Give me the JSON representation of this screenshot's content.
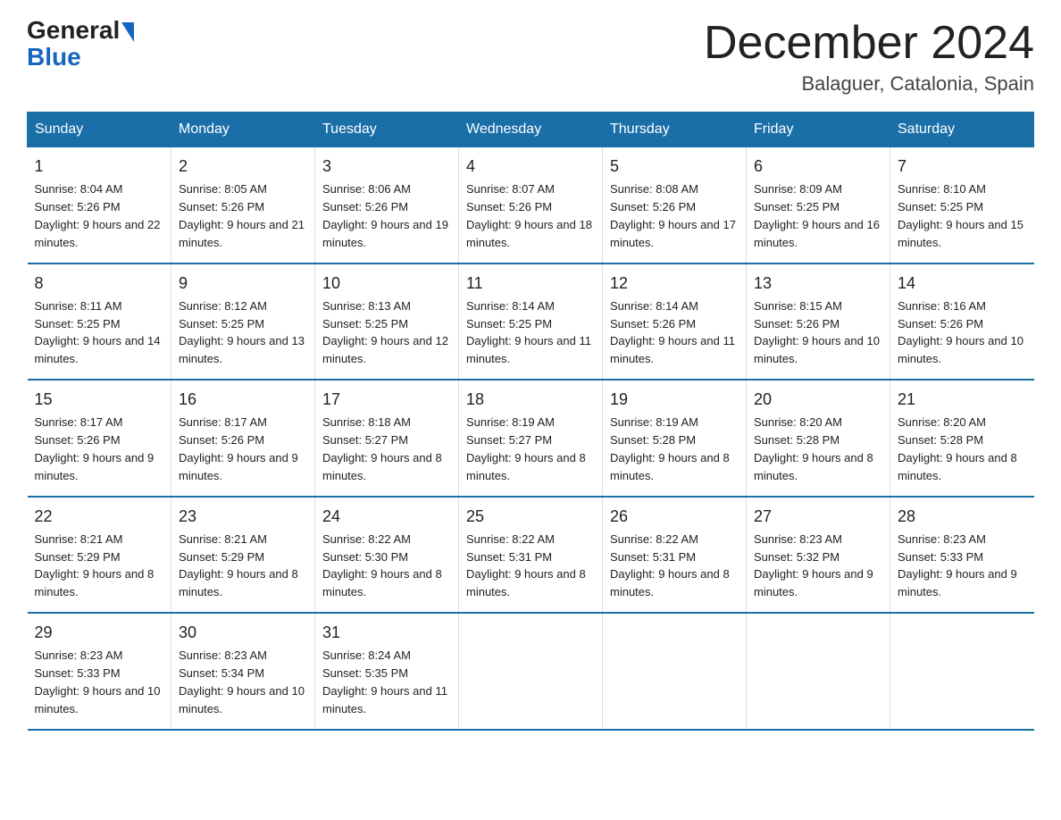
{
  "header": {
    "logo_general": "General",
    "logo_blue": "Blue",
    "month_title": "December 2024",
    "location": "Balaguer, Catalonia, Spain"
  },
  "days_of_week": [
    "Sunday",
    "Monday",
    "Tuesday",
    "Wednesday",
    "Thursday",
    "Friday",
    "Saturday"
  ],
  "weeks": [
    [
      {
        "num": "1",
        "sunrise": "8:04 AM",
        "sunset": "5:26 PM",
        "daylight": "9 hours and 22 minutes."
      },
      {
        "num": "2",
        "sunrise": "8:05 AM",
        "sunset": "5:26 PM",
        "daylight": "9 hours and 21 minutes."
      },
      {
        "num": "3",
        "sunrise": "8:06 AM",
        "sunset": "5:26 PM",
        "daylight": "9 hours and 19 minutes."
      },
      {
        "num": "4",
        "sunrise": "8:07 AM",
        "sunset": "5:26 PM",
        "daylight": "9 hours and 18 minutes."
      },
      {
        "num": "5",
        "sunrise": "8:08 AM",
        "sunset": "5:26 PM",
        "daylight": "9 hours and 17 minutes."
      },
      {
        "num": "6",
        "sunrise": "8:09 AM",
        "sunset": "5:25 PM",
        "daylight": "9 hours and 16 minutes."
      },
      {
        "num": "7",
        "sunrise": "8:10 AM",
        "sunset": "5:25 PM",
        "daylight": "9 hours and 15 minutes."
      }
    ],
    [
      {
        "num": "8",
        "sunrise": "8:11 AM",
        "sunset": "5:25 PM",
        "daylight": "9 hours and 14 minutes."
      },
      {
        "num": "9",
        "sunrise": "8:12 AM",
        "sunset": "5:25 PM",
        "daylight": "9 hours and 13 minutes."
      },
      {
        "num": "10",
        "sunrise": "8:13 AM",
        "sunset": "5:25 PM",
        "daylight": "9 hours and 12 minutes."
      },
      {
        "num": "11",
        "sunrise": "8:14 AM",
        "sunset": "5:25 PM",
        "daylight": "9 hours and 11 minutes."
      },
      {
        "num": "12",
        "sunrise": "8:14 AM",
        "sunset": "5:26 PM",
        "daylight": "9 hours and 11 minutes."
      },
      {
        "num": "13",
        "sunrise": "8:15 AM",
        "sunset": "5:26 PM",
        "daylight": "9 hours and 10 minutes."
      },
      {
        "num": "14",
        "sunrise": "8:16 AM",
        "sunset": "5:26 PM",
        "daylight": "9 hours and 10 minutes."
      }
    ],
    [
      {
        "num": "15",
        "sunrise": "8:17 AM",
        "sunset": "5:26 PM",
        "daylight": "9 hours and 9 minutes."
      },
      {
        "num": "16",
        "sunrise": "8:17 AM",
        "sunset": "5:26 PM",
        "daylight": "9 hours and 9 minutes."
      },
      {
        "num": "17",
        "sunrise": "8:18 AM",
        "sunset": "5:27 PM",
        "daylight": "9 hours and 8 minutes."
      },
      {
        "num": "18",
        "sunrise": "8:19 AM",
        "sunset": "5:27 PM",
        "daylight": "9 hours and 8 minutes."
      },
      {
        "num": "19",
        "sunrise": "8:19 AM",
        "sunset": "5:28 PM",
        "daylight": "9 hours and 8 minutes."
      },
      {
        "num": "20",
        "sunrise": "8:20 AM",
        "sunset": "5:28 PM",
        "daylight": "9 hours and 8 minutes."
      },
      {
        "num": "21",
        "sunrise": "8:20 AM",
        "sunset": "5:28 PM",
        "daylight": "9 hours and 8 minutes."
      }
    ],
    [
      {
        "num": "22",
        "sunrise": "8:21 AM",
        "sunset": "5:29 PM",
        "daylight": "9 hours and 8 minutes."
      },
      {
        "num": "23",
        "sunrise": "8:21 AM",
        "sunset": "5:29 PM",
        "daylight": "9 hours and 8 minutes."
      },
      {
        "num": "24",
        "sunrise": "8:22 AM",
        "sunset": "5:30 PM",
        "daylight": "9 hours and 8 minutes."
      },
      {
        "num": "25",
        "sunrise": "8:22 AM",
        "sunset": "5:31 PM",
        "daylight": "9 hours and 8 minutes."
      },
      {
        "num": "26",
        "sunrise": "8:22 AM",
        "sunset": "5:31 PM",
        "daylight": "9 hours and 8 minutes."
      },
      {
        "num": "27",
        "sunrise": "8:23 AM",
        "sunset": "5:32 PM",
        "daylight": "9 hours and 9 minutes."
      },
      {
        "num": "28",
        "sunrise": "8:23 AM",
        "sunset": "5:33 PM",
        "daylight": "9 hours and 9 minutes."
      }
    ],
    [
      {
        "num": "29",
        "sunrise": "8:23 AM",
        "sunset": "5:33 PM",
        "daylight": "9 hours and 10 minutes."
      },
      {
        "num": "30",
        "sunrise": "8:23 AM",
        "sunset": "5:34 PM",
        "daylight": "9 hours and 10 minutes."
      },
      {
        "num": "31",
        "sunrise": "8:24 AM",
        "sunset": "5:35 PM",
        "daylight": "9 hours and 11 minutes."
      },
      null,
      null,
      null,
      null
    ]
  ]
}
